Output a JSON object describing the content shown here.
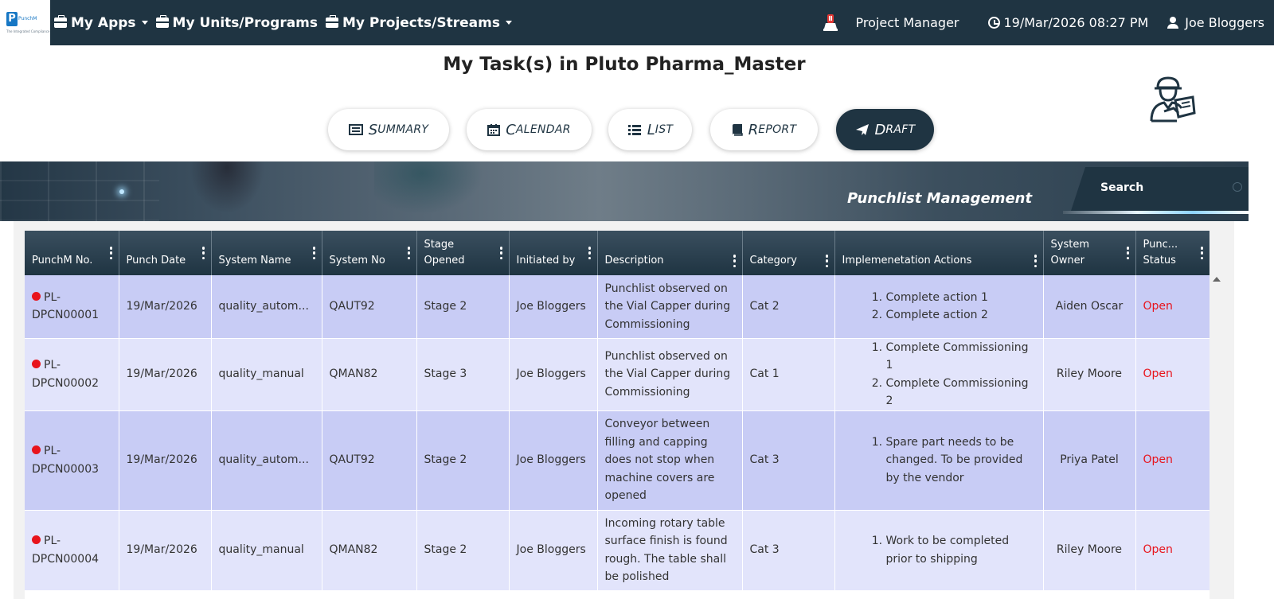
{
  "brand": {
    "logo_text": "PunchM",
    "tagline": "The Integrated Compliance"
  },
  "nav": {
    "menus": [
      {
        "label": "My Apps"
      },
      {
        "label": "My Units/Programs"
      },
      {
        "label": "My Projects/Streams"
      }
    ],
    "role": "Project Manager",
    "datetime": "19/Mar/2026 08:27 PM",
    "user": "Joe Bloggers"
  },
  "page_title": "My Task(s) in Pluto Pharma_Master",
  "tabs": [
    {
      "first": "S",
      "rest": "UMMARY",
      "icon": "summary-icon"
    },
    {
      "first": "C",
      "rest": "ALENDAR",
      "icon": "calendar-icon"
    },
    {
      "first": "L",
      "rest": "IST",
      "icon": "list-icon"
    },
    {
      "first": "R",
      "rest": "EPORT",
      "icon": "report-icon"
    },
    {
      "first": "D",
      "rest": "RAFT",
      "icon": "paper-plane-icon",
      "active": true
    }
  ],
  "banner": {
    "title": "Punchlist Management",
    "search_label": "Search"
  },
  "table": {
    "columns": [
      "PunchM No.",
      "Punch Date",
      "System Name",
      "System No",
      "Stage Opened",
      "Initiated by",
      "Description",
      "Category",
      "Implemenetation Actions",
      "System Owner",
      "Punc... Status"
    ],
    "rows": [
      {
        "no": "PL-DPCN00001",
        "date": "19/Mar/2026",
        "system_name": "quality_autom...",
        "system_no": "QAUT92",
        "stage": "Stage 2",
        "initiated_by": "Joe Bloggers",
        "description": "Punchlist observed on the Vial Capper during Commissioning",
        "category": "Cat 2",
        "actions": [
          "Complete action 1",
          "Complete action 2"
        ],
        "owner": "Aiden Oscar",
        "status": "Open"
      },
      {
        "no": "PL-DPCN00002",
        "date": "19/Mar/2026",
        "system_name": "quality_manual",
        "system_no": "QMAN82",
        "stage": "Stage 3",
        "initiated_by": "Joe Bloggers",
        "description": "Punchlist observed on the Vial Capper during Commissioning",
        "category": "Cat 1",
        "actions": [
          "Complete Commissioning 1",
          "Complete Commissioning 2"
        ],
        "owner": "Riley Moore",
        "status": "Open"
      },
      {
        "no": "PL-DPCN00003",
        "date": "19/Mar/2026",
        "system_name": "quality_autom...",
        "system_no": "QAUT92",
        "stage": "Stage 2",
        "initiated_by": "Joe Bloggers",
        "description": "Conveyor between filling and capping does not stop when machine covers are opened",
        "category": "Cat 3",
        "actions": [
          "Spare part needs to be changed. To be provided by the vendor"
        ],
        "owner": "Priya Patel",
        "status": "Open"
      },
      {
        "no": "PL-DPCN00004",
        "date": "19/Mar/2026",
        "system_name": "quality_manual",
        "system_no": "QMAN82",
        "stage": "Stage 2",
        "initiated_by": "Joe Bloggers",
        "description": "Incoming rotary table surface finish is found rough. The table shall be polished",
        "category": "Cat 3",
        "actions": [
          "Work to be completed prior to shipping"
        ],
        "owner": "Riley Moore",
        "status": "Open"
      }
    ]
  },
  "colors": {
    "navbar": "#1f3442",
    "row_dark": "#c8ccf5",
    "row_light": "#e2e4fb",
    "status_open": "#e8141c"
  }
}
